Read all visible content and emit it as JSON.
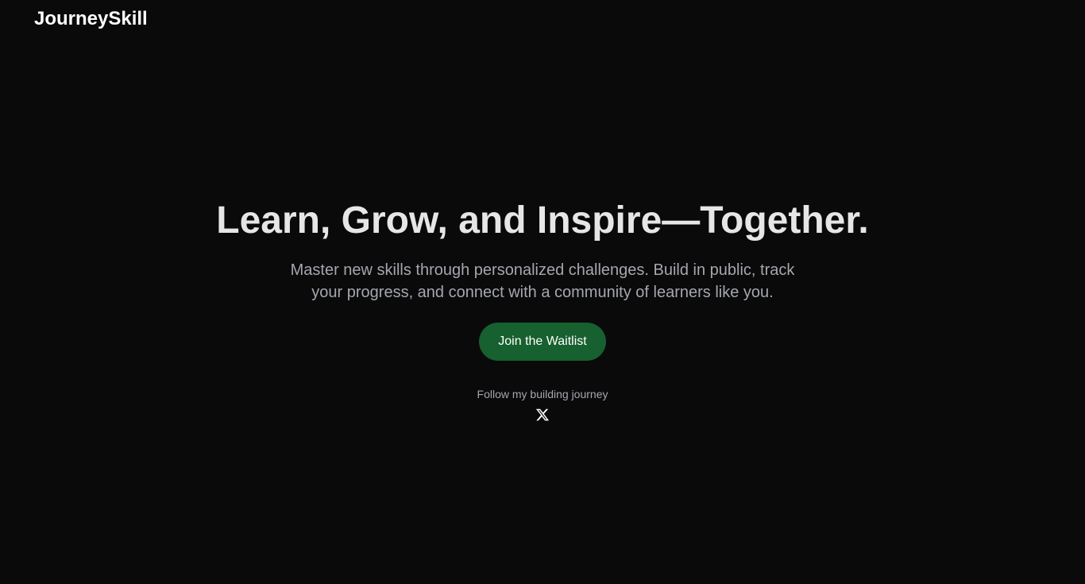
{
  "header": {
    "logo": "JourneySkill"
  },
  "hero": {
    "title": "Learn, Grow, and Inspire—Together.",
    "subtitle": "Master new skills through personalized challenges. Build in public, track your progress, and connect with a community of learners like you.",
    "cta_label": "Join the Waitlist",
    "follow_text": "Follow my building journey",
    "social_icon": "x-twitter-icon"
  },
  "colors": {
    "background": "#0a0a0a",
    "title": "#e6e6e6",
    "muted_text": "#a4a7ae",
    "accent": "#17602f",
    "white": "#ffffff"
  }
}
